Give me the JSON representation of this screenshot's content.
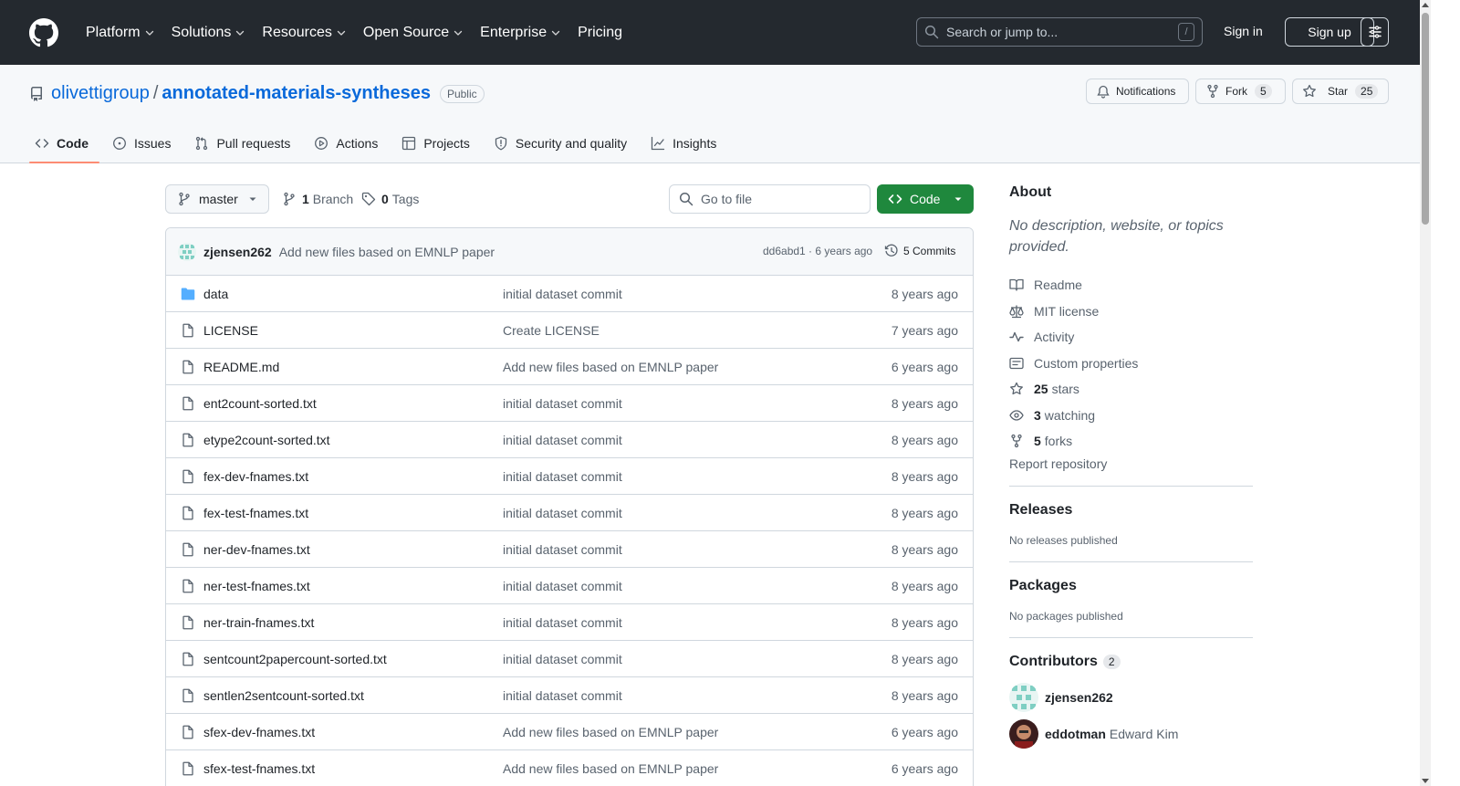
{
  "header": {
    "nav": [
      {
        "label": "Platform",
        "chevron": true
      },
      {
        "label": "Solutions",
        "chevron": true
      },
      {
        "label": "Resources",
        "chevron": true
      },
      {
        "label": "Open Source",
        "chevron": true
      },
      {
        "label": "Enterprise",
        "chevron": true
      },
      {
        "label": "Pricing",
        "chevron": false
      }
    ],
    "search_placeholder": "Search or jump to...",
    "search_key": "/",
    "sign_in": "Sign in",
    "sign_up": "Sign up"
  },
  "repo": {
    "owner": "olivettigroup",
    "separator": "/",
    "name": "annotated-materials-syntheses",
    "visibility": "Public",
    "notifications_label": "Notifications",
    "fork_label": "Fork",
    "fork_count": "5",
    "star_label": "Star",
    "star_count": "25"
  },
  "tabs": [
    {
      "label": "Code",
      "icon": "code-icon",
      "active": true
    },
    {
      "label": "Issues",
      "icon": "issue-icon",
      "active": false
    },
    {
      "label": "Pull requests",
      "icon": "pull-request-icon",
      "active": false
    },
    {
      "label": "Actions",
      "icon": "play-icon",
      "active": false
    },
    {
      "label": "Projects",
      "icon": "table-icon",
      "active": false
    },
    {
      "label": "Security and quality",
      "icon": "shield-icon",
      "active": false
    },
    {
      "label": "Insights",
      "icon": "graph-icon",
      "active": false
    }
  ],
  "toolbar": {
    "branch": "master",
    "branch_count": "1",
    "branch_label": "Branch",
    "tag_count": "0",
    "tag_label": "Tags",
    "goto_placeholder": "Go to file",
    "code_label": "Code"
  },
  "commit": {
    "author": "zjensen262",
    "message": "Add new files based on EMNLP paper",
    "meta": "dd6abd1 · 6 years ago",
    "commits": "5 Commits"
  },
  "files": [
    {
      "type": "dir",
      "name": "data",
      "message": "initial dataset commit",
      "age": "8 years ago"
    },
    {
      "type": "file",
      "name": "LICENSE",
      "message": "Create LICENSE",
      "age": "7 years ago"
    },
    {
      "type": "file",
      "name": "README.md",
      "message": "Add new files based on EMNLP paper",
      "age": "6 years ago"
    },
    {
      "type": "file",
      "name": "ent2count-sorted.txt",
      "message": "initial dataset commit",
      "age": "8 years ago"
    },
    {
      "type": "file",
      "name": "etype2count-sorted.txt",
      "message": "initial dataset commit",
      "age": "8 years ago"
    },
    {
      "type": "file",
      "name": "fex-dev-fnames.txt",
      "message": "initial dataset commit",
      "age": "8 years ago"
    },
    {
      "type": "file",
      "name": "fex-test-fnames.txt",
      "message": "initial dataset commit",
      "age": "8 years ago"
    },
    {
      "type": "file",
      "name": "ner-dev-fnames.txt",
      "message": "initial dataset commit",
      "age": "8 years ago"
    },
    {
      "type": "file",
      "name": "ner-test-fnames.txt",
      "message": "initial dataset commit",
      "age": "8 years ago"
    },
    {
      "type": "file",
      "name": "ner-train-fnames.txt",
      "message": "initial dataset commit",
      "age": "8 years ago"
    },
    {
      "type": "file",
      "name": "sentcount2papercount-sorted.txt",
      "message": "initial dataset commit",
      "age": "8 years ago"
    },
    {
      "type": "file",
      "name": "sentlen2sentcount-sorted.txt",
      "message": "initial dataset commit",
      "age": "8 years ago"
    },
    {
      "type": "file",
      "name": "sfex-dev-fnames.txt",
      "message": "Add new files based on EMNLP paper",
      "age": "6 years ago"
    },
    {
      "type": "file",
      "name": "sfex-test-fnames.txt",
      "message": "Add new files based on EMNLP paper",
      "age": "6 years ago"
    }
  ],
  "sidebar": {
    "about_title": "About",
    "about_desc": "No description, website, or topics provided.",
    "readme": "Readme",
    "license": "MIT license",
    "activity": "Activity",
    "custom_properties": "Custom properties",
    "stars_count": "25",
    "stars_label": "stars",
    "watching_count": "3",
    "watching_label": "watching",
    "forks_count": "5",
    "forks_label": "forks",
    "report": "Report repository",
    "releases_title": "Releases",
    "releases_text": "No releases published",
    "packages_title": "Packages",
    "packages_text": "No packages published",
    "contributors_title": "Contributors",
    "contributors_count": "2",
    "contributors": [
      {
        "login": "zjensen262",
        "name": ""
      },
      {
        "login": "eddotman",
        "name": "Edward Kim"
      }
    ]
  },
  "colors": {
    "header_bg": "#24292f",
    "link": "#0969da",
    "code_button": "#1f883d",
    "active_tab_underline": "#fd8c73"
  }
}
